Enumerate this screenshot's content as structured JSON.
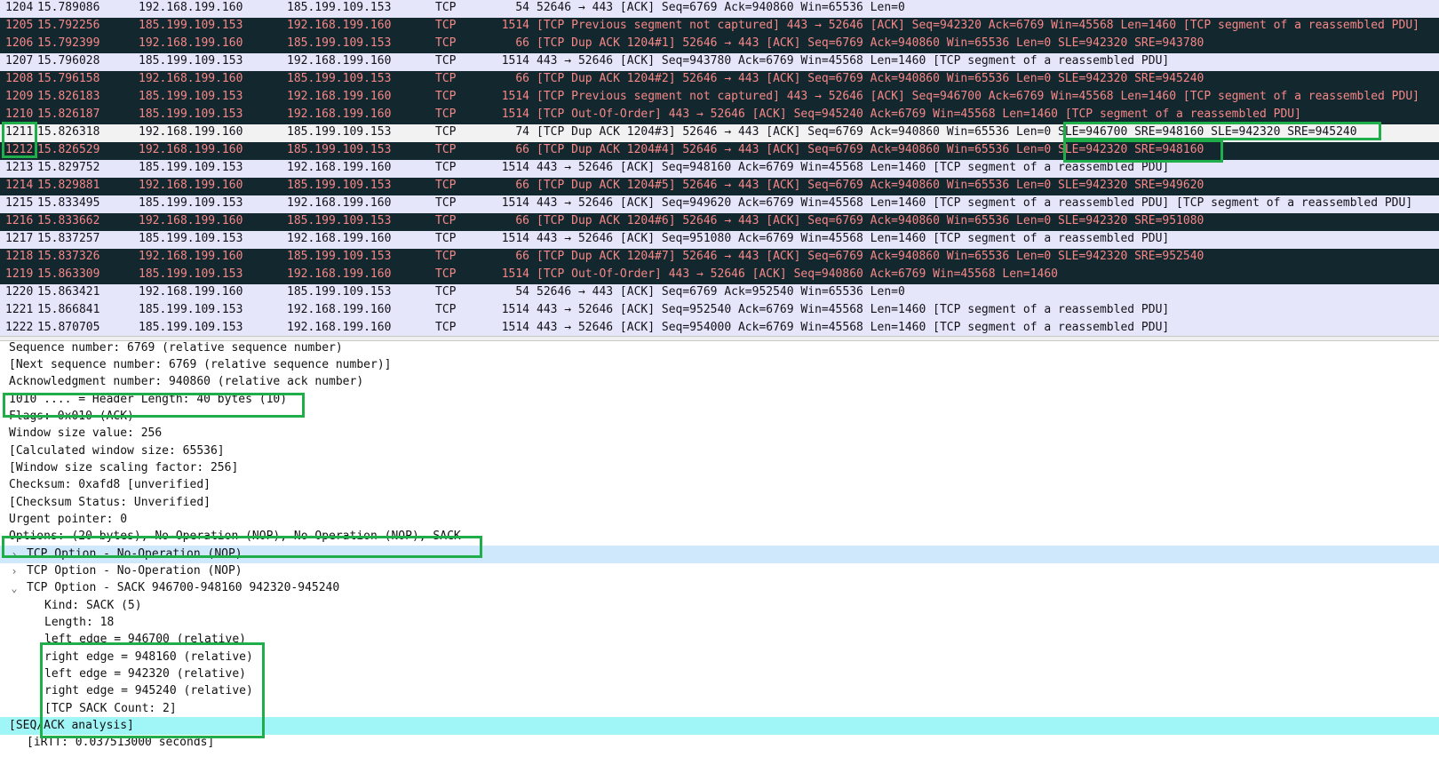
{
  "packets": [
    {
      "no": "1204",
      "time": "15.789086",
      "src": "192.168.199.160",
      "dst": "185.199.109.153",
      "proto": "TCP",
      "len": "54",
      "info": "52646 → 443 [ACK] Seq=6769 Ack=940860 Win=65536 Len=0",
      "style": "normal"
    },
    {
      "no": "1205",
      "time": "15.792256",
      "src": "185.199.109.153",
      "dst": "192.168.199.160",
      "proto": "TCP",
      "len": "1514",
      "info": "[TCP Previous segment not captured] 443 → 52646 [ACK] Seq=942320 Ack=6769 Win=45568 Len=1460 [TCP segment of a reassembled PDU]",
      "style": "dark"
    },
    {
      "no": "1206",
      "time": "15.792399",
      "src": "192.168.199.160",
      "dst": "185.199.109.153",
      "proto": "TCP",
      "len": "66",
      "info": "[TCP Dup ACK 1204#1] 52646 → 443 [ACK] Seq=6769 Ack=940860 Win=65536 Len=0 SLE=942320 SRE=943780",
      "style": "dark"
    },
    {
      "no": "1207",
      "time": "15.796028",
      "src": "185.199.109.153",
      "dst": "192.168.199.160",
      "proto": "TCP",
      "len": "1514",
      "info": "443 → 52646 [ACK] Seq=943780 Ack=6769 Win=45568 Len=1460 [TCP segment of a reassembled PDU]",
      "style": "normal"
    },
    {
      "no": "1208",
      "time": "15.796158",
      "src": "192.168.199.160",
      "dst": "185.199.109.153",
      "proto": "TCP",
      "len": "66",
      "info": "[TCP Dup ACK 1204#2] 52646 → 443 [ACK] Seq=6769 Ack=940860 Win=65536 Len=0 SLE=942320 SRE=945240",
      "style": "dark"
    },
    {
      "no": "1209",
      "time": "15.826183",
      "src": "185.199.109.153",
      "dst": "192.168.199.160",
      "proto": "TCP",
      "len": "1514",
      "info": "[TCP Previous segment not captured] 443 → 52646 [ACK] Seq=946700 Ack=6769 Win=45568 Len=1460 [TCP segment of a reassembled PDU]",
      "style": "dark"
    },
    {
      "no": "1210",
      "time": "15.826187",
      "src": "185.199.109.153",
      "dst": "192.168.199.160",
      "proto": "TCP",
      "len": "1514",
      "info": "[TCP Out-Of-Order] 443 → 52646 [ACK] Seq=945240 Ack=6769 Win=45568 Len=1460 [TCP segment of a reassembled PDU]",
      "style": "dark"
    },
    {
      "no": "1211",
      "time": "15.826318",
      "src": "192.168.199.160",
      "dst": "185.199.109.153",
      "proto": "TCP",
      "len": "74",
      "info": "[TCP Dup ACK 1204#3] 52646 → 443 [ACK] Seq=6769 Ack=940860 Win=65536 Len=0 SLE=946700 SRE=948160 SLE=942320 SRE=945240",
      "style": "selected"
    },
    {
      "no": "1212",
      "time": "15.826529",
      "src": "192.168.199.160",
      "dst": "185.199.109.153",
      "proto": "TCP",
      "len": "66",
      "info": "[TCP Dup ACK 1204#4] 52646 → 443 [ACK] Seq=6769 Ack=940860 Win=65536 Len=0 SLE=942320 SRE=948160",
      "style": "dark"
    },
    {
      "no": "1213",
      "time": "15.829752",
      "src": "185.199.109.153",
      "dst": "192.168.199.160",
      "proto": "TCP",
      "len": "1514",
      "info": "443 → 52646 [ACK] Seq=948160 Ack=6769 Win=45568 Len=1460 [TCP segment of a reassembled PDU]",
      "style": "normal"
    },
    {
      "no": "1214",
      "time": "15.829881",
      "src": "192.168.199.160",
      "dst": "185.199.109.153",
      "proto": "TCP",
      "len": "66",
      "info": "[TCP Dup ACK 1204#5] 52646 → 443 [ACK] Seq=6769 Ack=940860 Win=65536 Len=0 SLE=942320 SRE=949620",
      "style": "dark"
    },
    {
      "no": "1215",
      "time": "15.833495",
      "src": "185.199.109.153",
      "dst": "192.168.199.160",
      "proto": "TCP",
      "len": "1514",
      "info": "443 → 52646 [ACK] Seq=949620 Ack=6769 Win=45568 Len=1460 [TCP segment of a reassembled PDU] [TCP segment of a reassembled PDU]",
      "style": "normal"
    },
    {
      "no": "1216",
      "time": "15.833662",
      "src": "192.168.199.160",
      "dst": "185.199.109.153",
      "proto": "TCP",
      "len": "66",
      "info": "[TCP Dup ACK 1204#6] 52646 → 443 [ACK] Seq=6769 Ack=940860 Win=65536 Len=0 SLE=942320 SRE=951080",
      "style": "dark"
    },
    {
      "no": "1217",
      "time": "15.837257",
      "src": "185.199.109.153",
      "dst": "192.168.199.160",
      "proto": "TCP",
      "len": "1514",
      "info": "443 → 52646 [ACK] Seq=951080 Ack=6769 Win=45568 Len=1460 [TCP segment of a reassembled PDU]",
      "style": "normal"
    },
    {
      "no": "1218",
      "time": "15.837326",
      "src": "192.168.199.160",
      "dst": "185.199.109.153",
      "proto": "TCP",
      "len": "66",
      "info": "[TCP Dup ACK 1204#7] 52646 → 443 [ACK] Seq=6769 Ack=940860 Win=65536 Len=0 SLE=942320 SRE=952540",
      "style": "dark"
    },
    {
      "no": "1219",
      "time": "15.863309",
      "src": "185.199.109.153",
      "dst": "192.168.199.160",
      "proto": "TCP",
      "len": "1514",
      "info": "[TCP Out-Of-Order] 443 → 52646 [ACK] Seq=940860 Ack=6769 Win=45568 Len=1460",
      "style": "dark"
    },
    {
      "no": "1220",
      "time": "15.863421",
      "src": "192.168.199.160",
      "dst": "185.199.109.153",
      "proto": "TCP",
      "len": "54",
      "info": "52646 → 443 [ACK] Seq=6769 Ack=952540 Win=65536 Len=0",
      "style": "normal"
    },
    {
      "no": "1221",
      "time": "15.866841",
      "src": "185.199.109.153",
      "dst": "192.168.199.160",
      "proto": "TCP",
      "len": "1514",
      "info": "443 → 52646 [ACK] Seq=952540 Ack=6769 Win=45568 Len=1460 [TCP segment of a reassembled PDU]",
      "style": "normal"
    },
    {
      "no": "1222",
      "time": "15.870705",
      "src": "185.199.109.153",
      "dst": "192.168.199.160",
      "proto": "TCP",
      "len": "1514",
      "info": "443 → 52646 [ACK] Seq=954000 Ack=6769 Win=45568 Len=1460 [TCP segment of a reassembled PDU]",
      "style": "normal"
    }
  ],
  "details": {
    "seq": "Sequence number: 6769    (relative sequence number)",
    "next_seq": "[Next sequence number: 6769    (relative sequence number)]",
    "ack": "Acknowledgment number: 940860    (relative ack number)",
    "header_len": "1010 .... = Header Length: 40 bytes (10)",
    "flags": "Flags: 0x010 (ACK)",
    "win_value": "Window size value: 256",
    "calc_win": "[Calculated window size: 65536]",
    "win_scale": "[Window size scaling factor: 256]",
    "checksum": "Checksum: 0xafd8 [unverified]",
    "checksum_status": "[Checksum Status: Unverified]",
    "urgent": "Urgent pointer: 0",
    "options": "Options: (20 bytes), No-Operation (NOP), No-Operation (NOP), SACK",
    "opt_nop1": "TCP Option - No-Operation (NOP)",
    "opt_nop2": "TCP Option - No-Operation (NOP)",
    "opt_sack": "TCP Option - SACK 946700-948160 942320-945240",
    "sack_kind": "Kind: SACK (5)",
    "sack_length": "Length: 18",
    "left_edge_1": "left edge = 946700 (relative)",
    "right_edge_1": "right edge = 948160 (relative)",
    "left_edge_2": "left edge = 942320 (relative)",
    "right_edge_2": "right edge = 945240 (relative)",
    "sack_count": "[TCP SACK Count: 2]",
    "seqack": "[SEQ/ACK analysis]",
    "irtt": "[iRTT: 0.037513000 seconds]",
    "expander_collapsed": "›",
    "expander_expanded": "⌄"
  },
  "colors": {
    "list_bg": "#e6e6fa",
    "dark_row_bg": "#12272e",
    "dark_row_fg": "#f78787",
    "highlight_box": "#1fae4a"
  }
}
